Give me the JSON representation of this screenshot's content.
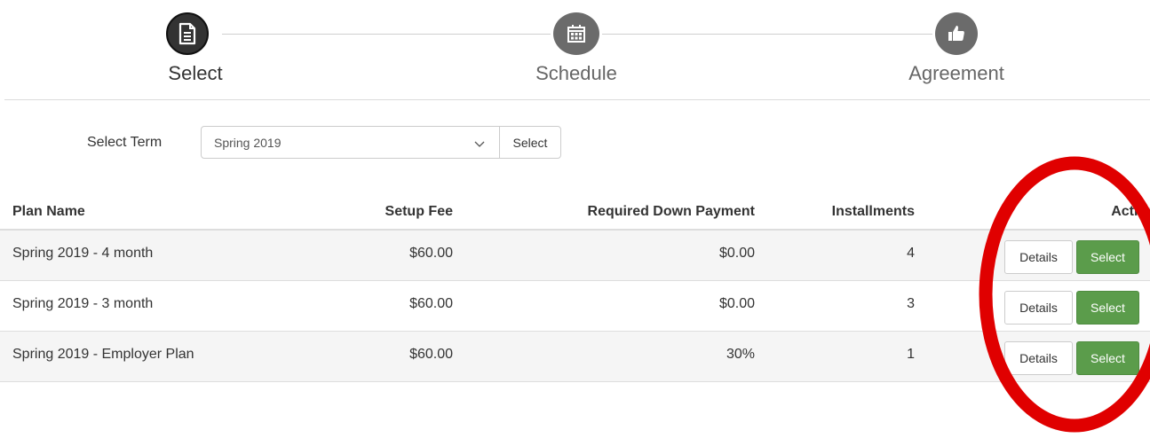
{
  "stepper": {
    "steps": [
      {
        "label": "Select",
        "icon": "document-icon",
        "state": "active"
      },
      {
        "label": "Schedule",
        "icon": "calendar-icon",
        "state": "inactive"
      },
      {
        "label": "Agreement",
        "icon": "thumbs-up-icon",
        "state": "inactive"
      }
    ]
  },
  "term": {
    "label": "Select Term",
    "selected": "Spring 2019",
    "button_label": "Select"
  },
  "table": {
    "headers": {
      "plan_name": "Plan Name",
      "setup_fee": "Setup Fee",
      "down_payment": "Required Down Payment",
      "installments": "Installments",
      "action": "Action"
    },
    "rows": [
      {
        "plan_name": "Spring 2019 - 4 month",
        "setup_fee": "$60.00",
        "down_payment": "$0.00",
        "installments": "4",
        "details_label": "Details",
        "select_label": "Select"
      },
      {
        "plan_name": "Spring 2019 - 3 month",
        "setup_fee": "$60.00",
        "down_payment": "$0.00",
        "installments": "3",
        "details_label": "Details",
        "select_label": "Select"
      },
      {
        "plan_name": "Spring 2019 - Employer Plan",
        "setup_fee": "$60.00",
        "down_payment": "30%",
        "installments": "1",
        "details_label": "Details",
        "select_label": "Select"
      }
    ]
  },
  "colors": {
    "select_button": "#5b9c4b",
    "active_step": "#333333",
    "inactive_step": "#6b6b6b",
    "annotation": "#e00000"
  }
}
